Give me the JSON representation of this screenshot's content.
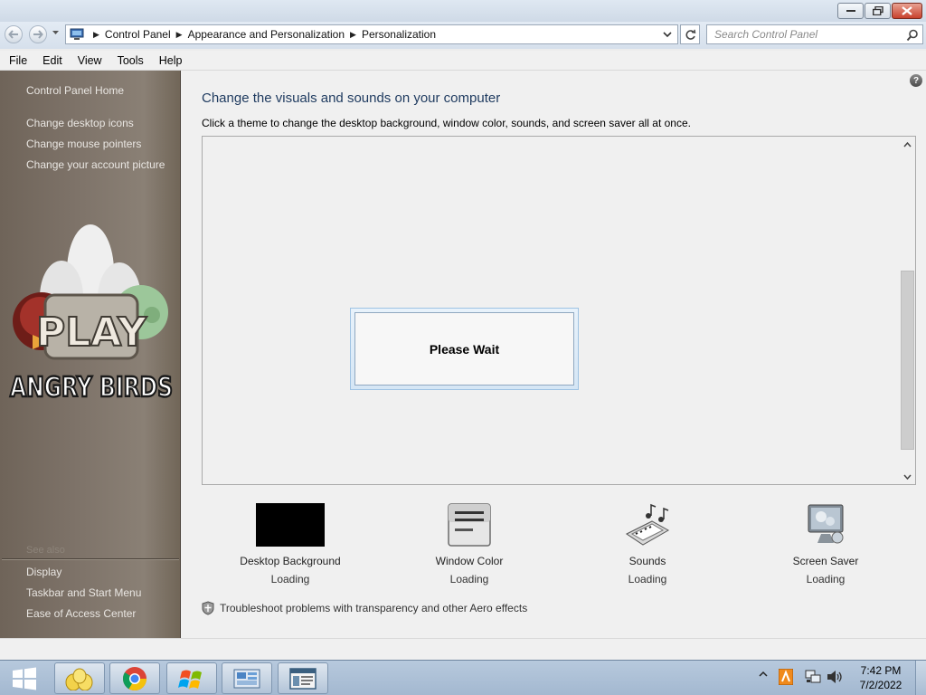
{
  "addressbar": {
    "breadcrumbs": [
      "Control Panel",
      "Appearance and Personalization",
      "Personalization"
    ],
    "search_placeholder": "Search Control Panel"
  },
  "menubar": {
    "items": [
      "File",
      "Edit",
      "View",
      "Tools",
      "Help"
    ]
  },
  "sidebar": {
    "home": "Control Panel Home",
    "tasks": [
      "Change desktop icons",
      "Change mouse pointers",
      "Change your account picture"
    ],
    "see_also_label": "See also",
    "see_also": [
      "Display",
      "Taskbar and Start Menu",
      "Ease of Access Center"
    ],
    "art_text_1": "PLAY",
    "art_text_2": "ANGRY BIRDS"
  },
  "main": {
    "help_glyph": "?",
    "title": "Change the visuals and sounds on your computer",
    "subtitle": "Click a theme to change the desktop background, window color, sounds, and screen saver all at once.",
    "dialog_text": "Please Wait",
    "settings": [
      {
        "label": "Desktop Background",
        "status": "Loading",
        "icon": "desktop-background-icon"
      },
      {
        "label": "Window Color",
        "status": "Loading",
        "icon": "window-color-icon"
      },
      {
        "label": "Sounds",
        "status": "Loading",
        "icon": "sounds-icon"
      },
      {
        "label": "Screen Saver",
        "status": "Loading",
        "icon": "screen-saver-icon"
      }
    ],
    "troubleshoot": "Troubleshoot problems with transparency and other Aero effects"
  },
  "taskbar": {
    "time": "7:42 PM",
    "date": "7/2/2022"
  },
  "colors": {
    "sidebar_bg": "#7d7268",
    "sidebar_text": "#e9e6e2",
    "title_blue": "#1e3a5f",
    "taskbar": "#a3b8d0"
  }
}
